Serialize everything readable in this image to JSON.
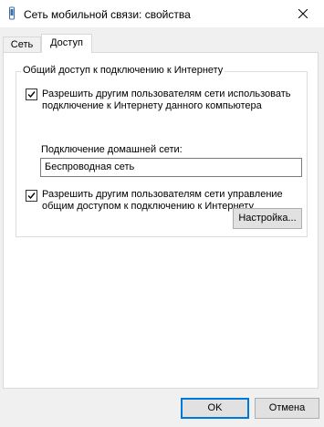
{
  "window": {
    "title": "Сеть мобильной связи: свойства",
    "icon": "mobile-network-icon",
    "close_icon": "close-icon"
  },
  "tabs": [
    {
      "label": "Сеть",
      "active": false
    },
    {
      "label": "Доступ",
      "active": true
    }
  ],
  "sharing": {
    "group_title": "Общий доступ к подключению к Интернету",
    "allow_other_users": {
      "checked": true,
      "line1": "Разрешить другим пользователям сети использовать",
      "line2": "подключение к Интернету данного компьютера"
    },
    "home_connection_label": "Подключение домашней сети:",
    "home_connection_value": "Беспроводная сеть",
    "allow_control": {
      "checked": true,
      "line1": "Разрешить другим пользователям сети управление",
      "line2": "общим доступом к подключению к Интернету"
    },
    "settings_button": "Настройка..."
  },
  "footer": {
    "ok": "OK",
    "cancel": "Отмена"
  },
  "colors": {
    "background": "#f0f0f0",
    "panel": "#ffffff",
    "accent": "#0078d7"
  }
}
